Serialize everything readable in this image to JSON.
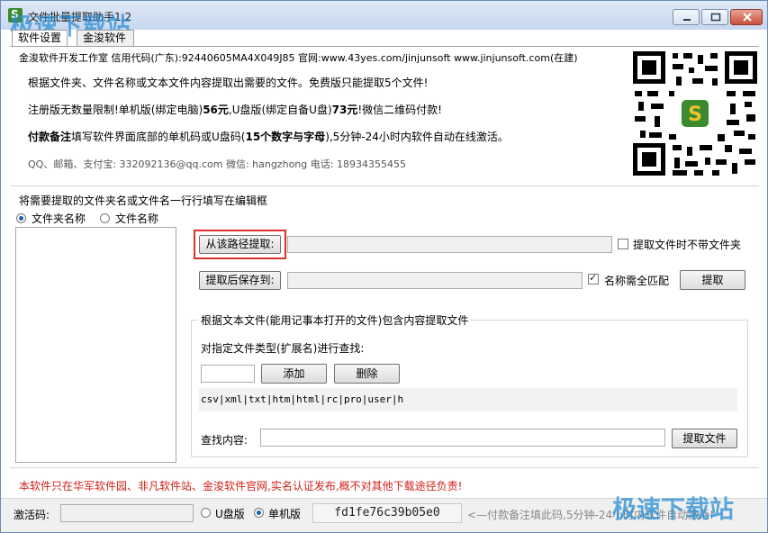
{
  "window": {
    "app_icon_letter": "S",
    "title": "文件批量提取助手1.2",
    "watermark_top": "极速下载站",
    "watermark_bottom": "极速下载站"
  },
  "tabs": [
    {
      "label": "软件设置"
    },
    {
      "label": "金浚软件"
    }
  ],
  "info": {
    "line1": "金浚软件开发工作室 信用代码(广东):92440605MA4X049J85 官网:www.43yes.com/jinjunsoft  www.jinjunsoft.com(在建)",
    "line2": "根据文件夹、文件名称或文本文件内容提取出需要的文件。免费版只能提取5个文件!",
    "line3_a": "注册版无数量限制!单机版(绑定电脑)",
    "line3_b": "56元",
    "line3_c": ",U盘版(绑定自备U盘)",
    "line3_d": "73元",
    "line3_e": "!微信二维码付款!",
    "line4_a": "付款备注",
    "line4_b": "填写软件界面底部的单机码或U盘码(",
    "line4_c": "15个数字与字母",
    "line4_d": "),5分钟-24小时内软件自动在线激活。",
    "line5": "QQ、邮箱、支付宝: 332092136@qq.com  微信: hangzhong  电话: 18934355455"
  },
  "qr_badge": "S",
  "source": {
    "instruction": "将需要提取的文件夹名或文件名一行行填写在编辑框",
    "radio_folder": "文件夹名称",
    "radio_file": "文件名称"
  },
  "extract": {
    "path_button": "从该路径提取:",
    "path_value": "",
    "no_folder_label": "提取文件时不带文件夹",
    "save_button": "提取后保存到:",
    "save_value": "",
    "exact_match_label": "名称需全匹配",
    "extract_button": "提取"
  },
  "content_group": {
    "title": "根据文本文件(能用记事本打开的文件)包含内容提取文件",
    "type_label": "对指定文件类型(扩展名)进行查找:",
    "ext_value": "",
    "add_button": "添加",
    "delete_button": "删除",
    "extensions": "csv|xml|txt|htm|html|rc|pro|user|h",
    "search_label": "查找内容:",
    "search_value": "",
    "extract_file_button": "提取文件"
  },
  "notice": "本软件只在华军软件园、非凡软件站、金浚软件官网,实名认证发布,概不对其他下载途径负责!",
  "status": {
    "activation_label": "激活码:",
    "activation_value": "",
    "usb_radio": "U盘版",
    "single_radio": "单机版",
    "machine_code": "fd1fe76c39b05e0",
    "hint": "<—付款备注填此码,5分钟-24小时内软件自动激活!"
  },
  "colors": {
    "accent_red": "#d1201a",
    "highlight_box": "#e0302b",
    "watermark": "#288cd2"
  }
}
